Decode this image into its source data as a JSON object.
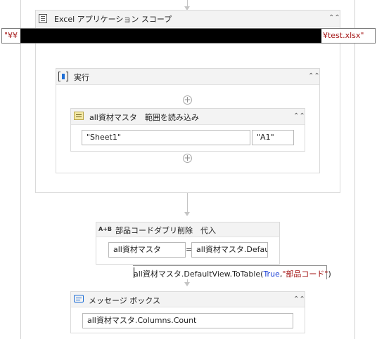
{
  "excel_scope": {
    "title": "Excel アプリケーション スコープ",
    "path_prefix": "\"¥¥",
    "path_suffix": "¥test.xlsx\""
  },
  "execute": {
    "title": "実行"
  },
  "read_range": {
    "title": "all資材マスタ　範囲を読み込み",
    "sheet": "\"Sheet1\"",
    "range": "\"A1\""
  },
  "assign": {
    "title": "部品コードダブリ削除　代入",
    "icon_text": "A+B",
    "to": "all資材マスタ",
    "operator": "=",
    "value": "all資材マスタ.Defau"
  },
  "expression_tooltip": {
    "prefix": "all資材マスタ.DefaultView.ToTable(",
    "keyword": "True",
    "separator": ",",
    "string": "\"部品コード\"",
    "suffix": ")"
  },
  "message_box": {
    "title": "メッセージ ボックス",
    "value": "all資材マスタ.Columns.Count"
  },
  "colors": {
    "keyword": "#1a3fd6",
    "string": "#a31515",
    "redacted": "#000000"
  }
}
